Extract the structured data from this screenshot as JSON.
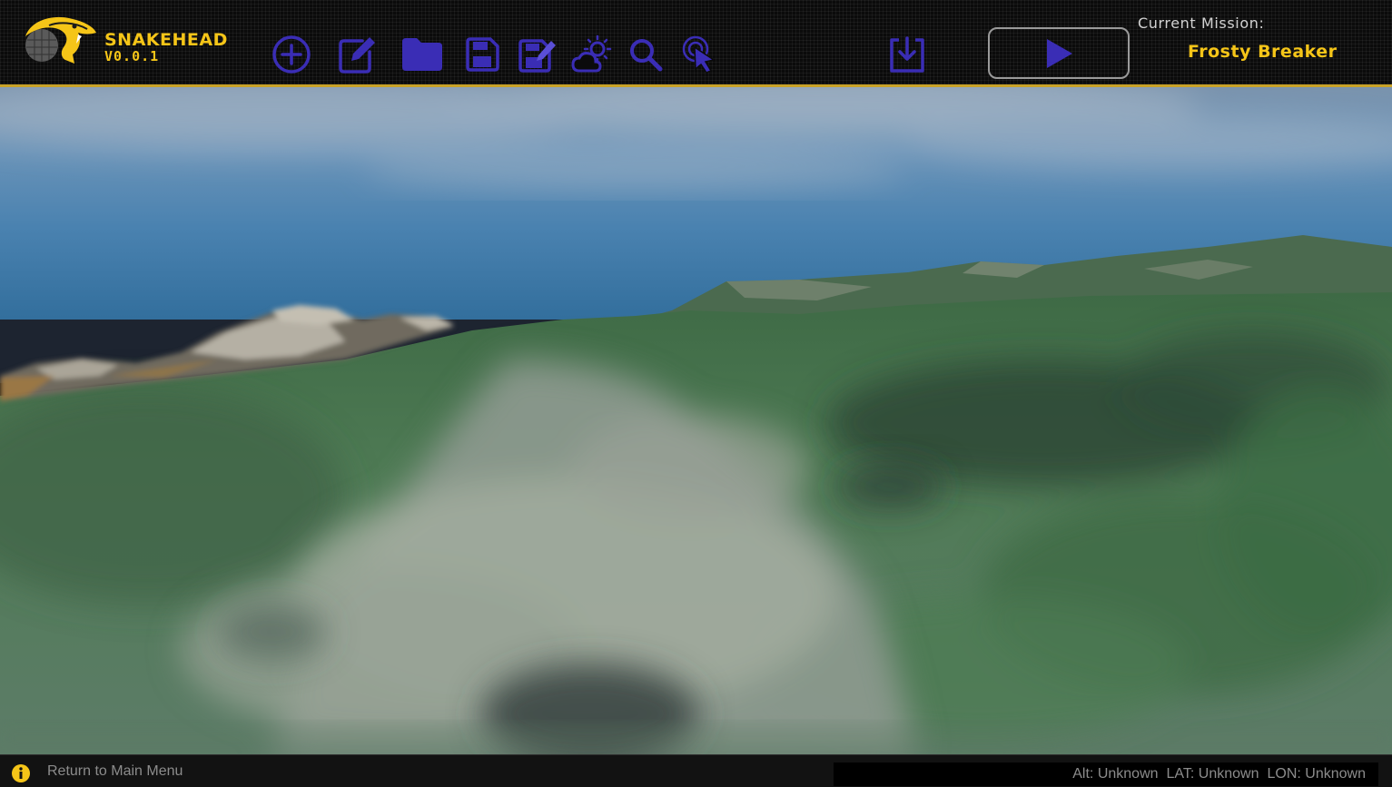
{
  "app": {
    "name": "SNAKEHEAD",
    "version": "V0.0.1"
  },
  "toolbar": {
    "buttons": [
      {
        "icon": "plus-circle-icon",
        "label": "New mission"
      },
      {
        "icon": "edit-icon",
        "label": "Edit mission"
      },
      {
        "icon": "folder-icon",
        "label": "Open mission"
      },
      {
        "icon": "save-icon",
        "label": "Save mission"
      },
      {
        "icon": "save-as-icon",
        "label": "Save mission as"
      },
      {
        "icon": "weather-icon",
        "label": "Weather"
      },
      {
        "icon": "search-icon",
        "label": "Search"
      },
      {
        "icon": "select-pointer-icon",
        "label": "Select"
      },
      {
        "icon": "download-icon",
        "label": "Export"
      }
    ],
    "play_icon": "play-icon"
  },
  "mission": {
    "label": "Current Mission:",
    "name": "Frosty Breaker"
  },
  "status": {
    "info_icon": "info-icon",
    "return_label": "Return to Main Menu",
    "alt": "Alt: Unknown",
    "lat": "LAT: Unknown",
    "lon": "LON: Unknown"
  },
  "colors": {
    "accent": "#f5c518",
    "icon": "#3a2db5",
    "toolbar_bg": "#0b0b0b",
    "statusbar_bg": "#121212"
  }
}
